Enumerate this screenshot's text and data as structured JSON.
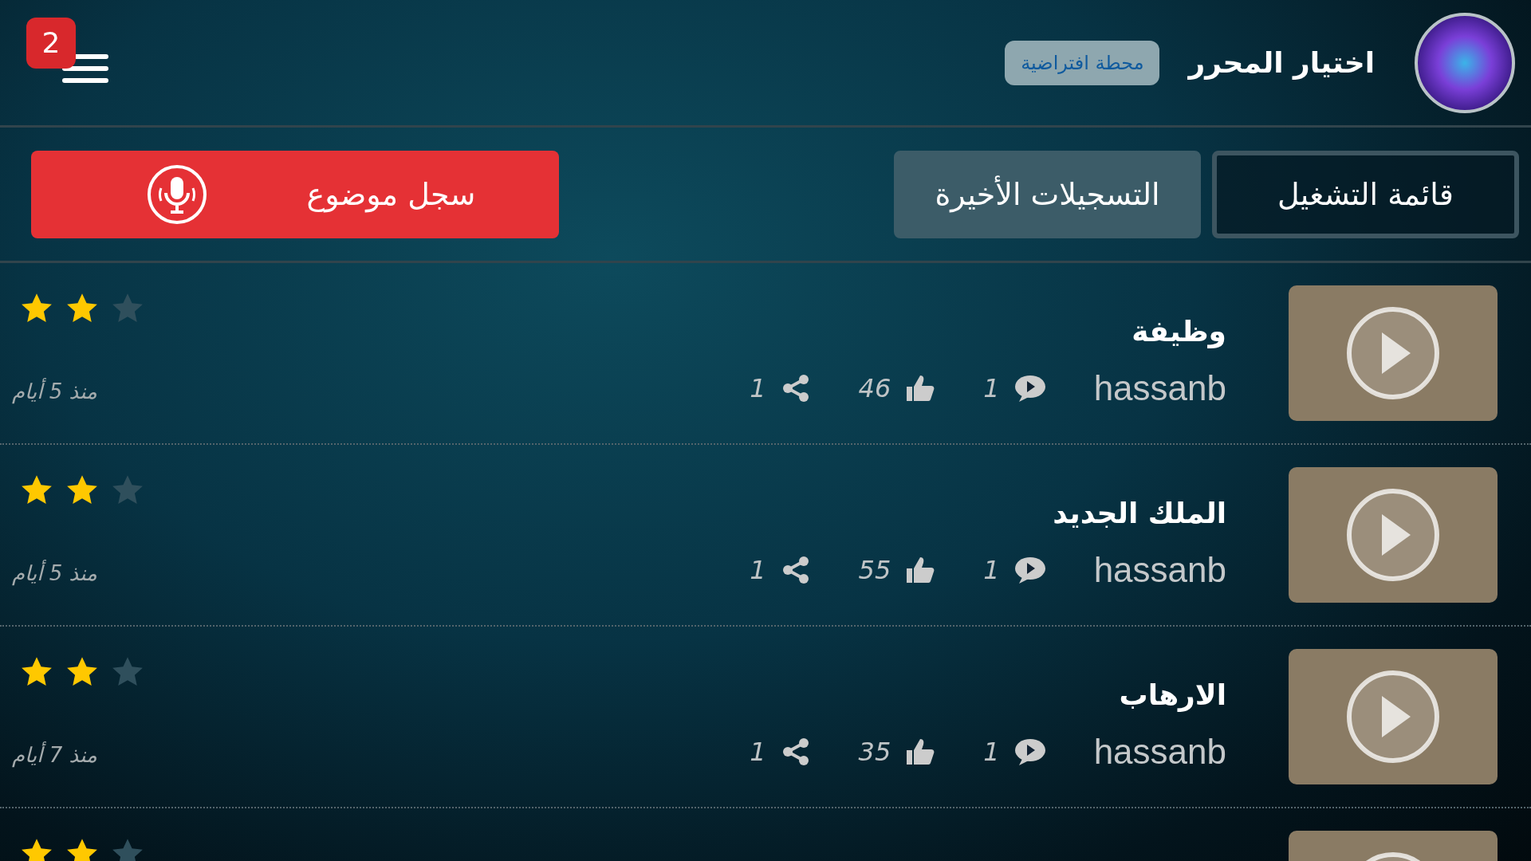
{
  "header": {
    "badge": "2",
    "station": "محطة افتراضية",
    "title": "اختيار المحرر"
  },
  "tabs": [
    {
      "label": "قائمة التشغيل",
      "selected": false
    },
    {
      "label": "التسجيلات الأخيرة",
      "selected": true
    }
  ],
  "record_button": {
    "label": "سجل موضوع"
  },
  "rows": [
    {
      "title": "وظيفة",
      "user": "hassanb",
      "comments": "1",
      "likes": "46",
      "shares": "1",
      "age": "منذ 5 أيام",
      "stars": 2
    },
    {
      "title": "الملك الجديد",
      "user": "hassanb",
      "comments": "1",
      "likes": "55",
      "shares": "1",
      "age": "منذ 5 أيام",
      "stars": 2
    },
    {
      "title": "الارهاب",
      "user": "hassanb",
      "comments": "1",
      "likes": "35",
      "shares": "1",
      "age": "منذ 7 أيام",
      "stars": 2
    },
    {
      "stars": 2
    }
  ]
}
